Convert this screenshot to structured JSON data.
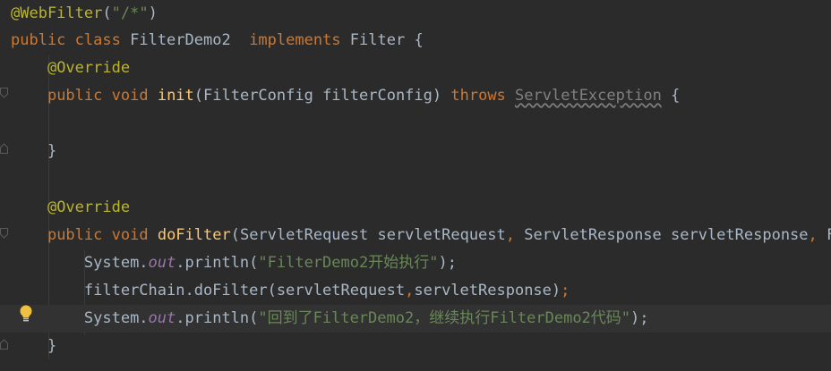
{
  "code": {
    "line1": {
      "annotation": "@WebFilter",
      "paren_open": "(",
      "string": "\"/*\"",
      "paren_close": ")"
    },
    "line2": {
      "kw_public": "public",
      "kw_class": "class",
      "class_name": "FilterDemo2",
      "kw_implements": "implements",
      "iface": "Filter",
      "brace": "{"
    },
    "line3": {
      "annotation": "@Override"
    },
    "line4": {
      "kw_public": "public",
      "kw_void": "void",
      "method": "init",
      "params": "(FilterConfig filterConfig)",
      "kw_throws": "throws",
      "exception": "ServletException",
      "brace": "{"
    },
    "line6": {
      "brace": "}"
    },
    "line8": {
      "annotation": "@Override"
    },
    "line9": {
      "kw_public": "public",
      "kw_void": "void",
      "method": "doFilter",
      "params_a": "(ServletRequest servletRequest",
      "comma1": ",",
      "params_b": " ServletResponse servletResponse",
      "comma2": ",",
      "params_c": " Fil"
    },
    "line10": {
      "sys": "System.",
      "out": "out",
      "println": ".println(",
      "string": "\"FilterDemo2开始执行\"",
      "end": ");"
    },
    "line11": {
      "call": "filterChain.doFilter(servletRequest",
      "comma": ",",
      "call_b": "servletResponse)",
      "semi": ";"
    },
    "line12": {
      "sys": "System.",
      "out": "out",
      "println": ".println(",
      "string": "\"回到了FilterDemo2，继续执行FilterDemo2代码\"",
      "end": ");"
    },
    "line13": {
      "brace": "}"
    }
  },
  "icons": {
    "intention": "lightbulb-icon",
    "fold": "fold-marker-icon"
  },
  "colors": {
    "background": "#2b2b2b",
    "keyword": "#cc7832",
    "annotation": "#bbb529",
    "string": "#6a8759",
    "method": "#ffc66d",
    "static_field": "#9876aa",
    "text": "#a9b7c6"
  }
}
